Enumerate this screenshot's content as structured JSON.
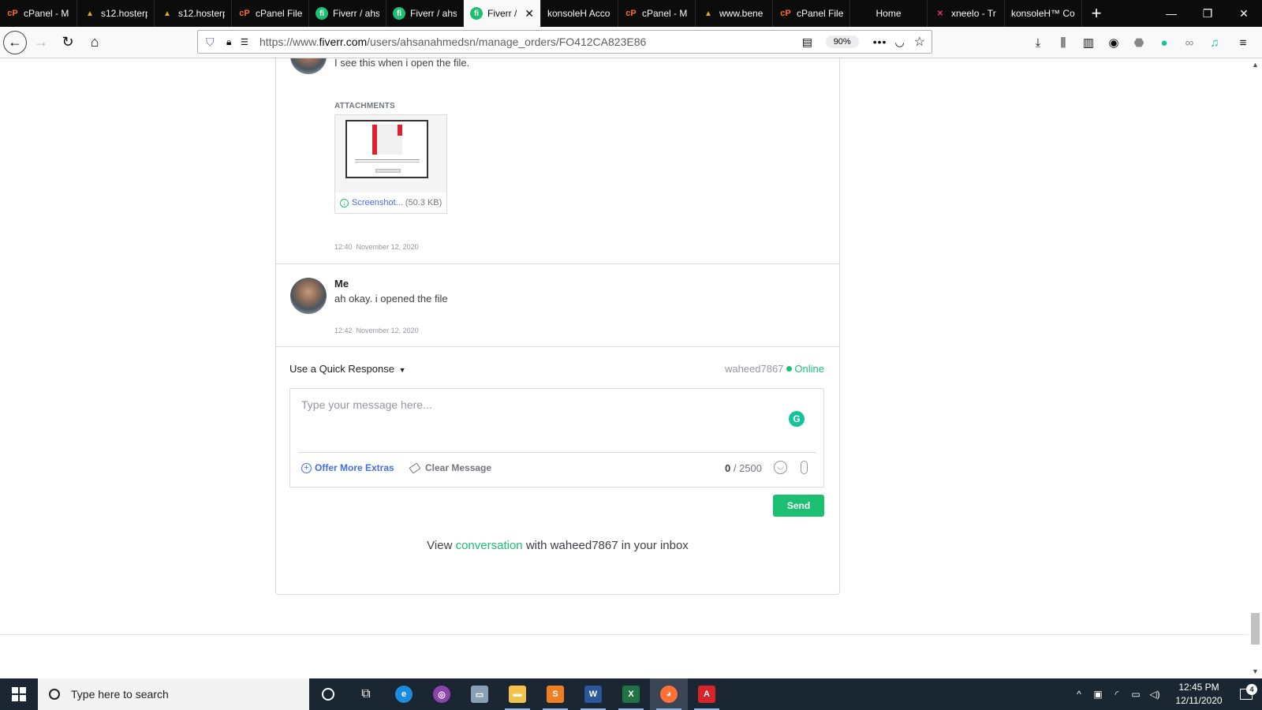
{
  "browser": {
    "tabs": [
      {
        "label": "cPanel - M",
        "icon": "cpanel-icon"
      },
      {
        "label": "s12.hosterp",
        "icon": "hosting-icon"
      },
      {
        "label": "s12.hosterp",
        "icon": "hosting-icon"
      },
      {
        "label": "cPanel File",
        "icon": "cpanel-icon"
      },
      {
        "label": "Fiverr / ahs",
        "icon": "fiverr-icon"
      },
      {
        "label": "Fiverr / ahs",
        "icon": "fiverr-icon"
      },
      {
        "label": "Fiverr /",
        "icon": "fiverr-icon",
        "active": true
      },
      {
        "label": "konsoleH Acco",
        "icon": "none"
      },
      {
        "label": "cPanel - M",
        "icon": "cpanel-icon"
      },
      {
        "label": "www.bene",
        "icon": "hosting-icon"
      },
      {
        "label": "cPanel File",
        "icon": "cpanel-icon"
      },
      {
        "label": "Home",
        "icon": "none"
      },
      {
        "label": "xneelo - Tr",
        "icon": "xneelo-icon"
      },
      {
        "label": "konsoleH™ Co",
        "icon": "none"
      }
    ],
    "url_prefix": "https://www.",
    "url_domain": "fiverr.com",
    "url_path": "/users/ahsanahmedsn/manage_orders/FO412CA823E86",
    "zoom": "90%"
  },
  "conversation": {
    "message_1": {
      "text": "I see this when i open the file.",
      "attachments_title": "ATTACHMENTS",
      "attachment_name": "Screenshot...",
      "attachment_size": "(50.3 KB)",
      "time": "12:40",
      "date": "November 12, 2020"
    },
    "message_2": {
      "sender": "Me",
      "text": "ah okay. i opened the file",
      "time": "12:42",
      "date": "November 12, 2020"
    },
    "quick_response_label": "Use a Quick Response",
    "recipient": "waheed7867",
    "status": "Online",
    "composer": {
      "placeholder": "Type your message here...",
      "offer_label": "Offer More Extras",
      "clear_label": "Clear Message",
      "char_count": "0",
      "char_max": "/ 2500"
    },
    "send_label": "Send",
    "inbox_prefix": "View",
    "inbox_link": "conversation",
    "inbox_suffix": "with waheed7867 in your inbox"
  },
  "taskbar": {
    "search_placeholder": "Type here to search",
    "time": "12:45 PM",
    "date": "12/11/2020",
    "notification_count": "4"
  },
  "colors": {
    "fiverr_green": "#1dbf73",
    "link_blue": "#446ee7",
    "taskbar_bg": "#1b2633",
    "tabbar_bg": "#0c0c0d"
  }
}
